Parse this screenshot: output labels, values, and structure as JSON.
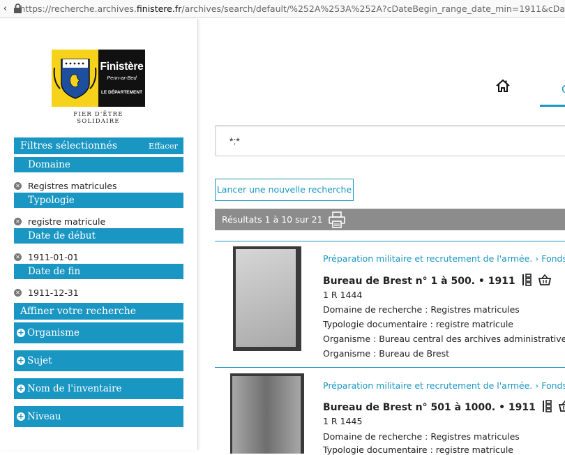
{
  "browser": {
    "url_prefix": "https://recherche.archives.",
    "url_domain": "finistere.fr",
    "url_suffix": "/archives/search/default/%252A%253A%252A?cDateBegin_range_date_min=1911&cDa"
  },
  "logo": {
    "name": "Finistère",
    "breton": "Penn-ar-Bed",
    "dept": "LE DÉPARTEMENT",
    "motto": "FIER D'ÊTRE SOLIDAIRE"
  },
  "filters": {
    "header": "Filtres sélectionnés",
    "clear": "Effacer",
    "groups": [
      {
        "label": "Domaine",
        "value": "Registres matricules"
      },
      {
        "label": "Typologie",
        "value": "registre matricule"
      },
      {
        "label": "Date de début",
        "value": "1911-01-01"
      },
      {
        "label": "Date de fin",
        "value": "1911-12-31"
      }
    ]
  },
  "refine": {
    "header": "Affiner votre recherche",
    "facets": [
      "Organisme",
      "Sujet",
      "Nom de l'inventaire",
      "Niveau"
    ]
  },
  "main": {
    "tab_letter": "C",
    "query": "*:*",
    "new_search": "Lancer une nouvelle recherche",
    "results_count": "Résultats 1 à 10 sur 21"
  },
  "results": [
    {
      "breadcrumb": "Préparation militaire et recrutement de l'armée. › Fonds du",
      "title": "Bureau de Brest n° 1 à 500. • 1911",
      "cote": "1 R 1444",
      "lines": [
        "Domaine de recherche : Registres matricules",
        "Typologie documentaire : registre matricule",
        "Organisme : Bureau central des archives administratives m",
        "Organisme : Bureau de Brest"
      ]
    },
    {
      "breadcrumb": "Préparation militaire et recrutement de l'armée. › Fonds du",
      "title": "Bureau de Brest n° 501 à 1000. • 1911",
      "cote": "1 R 1445",
      "lines": [
        "Domaine de recherche : Registres matricules",
        "Typologie documentaire : registre matricule"
      ]
    }
  ],
  "colors": {
    "accent": "#1a96c2",
    "results_bar": "#8c8c8c",
    "logo_yellow": "#f7d21b"
  }
}
